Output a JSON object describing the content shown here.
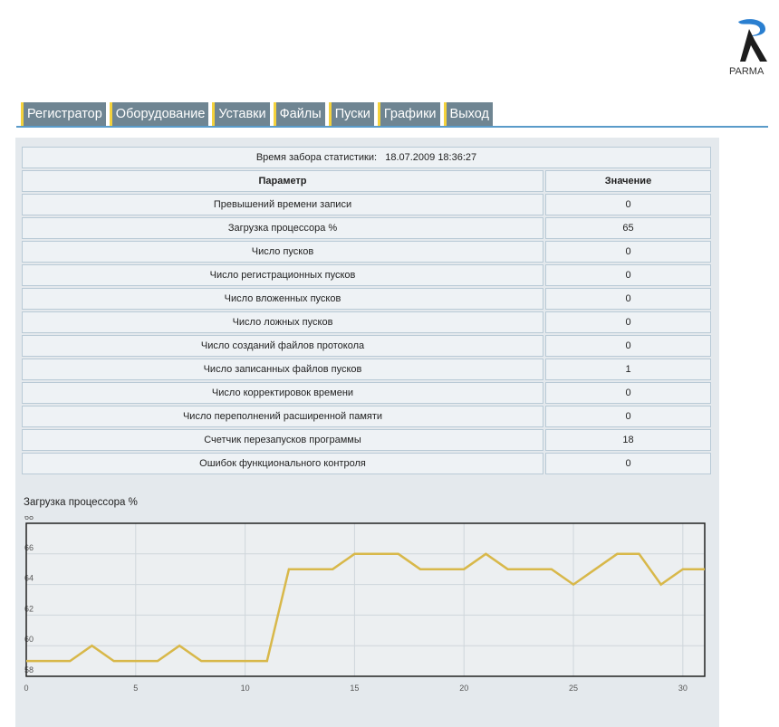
{
  "logo": {
    "name": "parma-logo-icon",
    "text": "PARMA"
  },
  "tabs": [
    {
      "label": "Регистратор"
    },
    {
      "label": "Оборудование"
    },
    {
      "label": "Уставки"
    },
    {
      "label": "Файлы"
    },
    {
      "label": "Пуски"
    },
    {
      "label": "Графики"
    },
    {
      "label": "Выход"
    }
  ],
  "stats": {
    "time_label": "Время забора статистики:",
    "time_value": "18.07.2009 18:36:27",
    "col_param": "Параметр",
    "col_value": "Значение",
    "rows": [
      {
        "param": "Превышений времени записи",
        "value": "0"
      },
      {
        "param": "Загрузка процессора %",
        "value": "65"
      },
      {
        "param": "Число пусков",
        "value": "0"
      },
      {
        "param": "Число регистрационных пусков",
        "value": "0"
      },
      {
        "param": "Число вложенных пусков",
        "value": "0"
      },
      {
        "param": "Число ложных пусков",
        "value": "0"
      },
      {
        "param": "Число созданий файлов протокола",
        "value": "0"
      },
      {
        "param": "Число записанных файлов пусков",
        "value": "1"
      },
      {
        "param": "Число корректировок времени",
        "value": "0"
      },
      {
        "param": "Число переполнений расширенной памяти",
        "value": "0"
      },
      {
        "param": "Счетчик перезапусков программы",
        "value": "18"
      },
      {
        "param": "Ошибок функционального контроля",
        "value": "0"
      }
    ]
  },
  "chart_data": {
    "type": "line",
    "title": "Загрузка процессора %",
    "xlim": [
      0,
      31
    ],
    "ylim": [
      58,
      68
    ],
    "x_ticks": [
      0,
      5,
      10,
      15,
      20,
      25,
      30
    ],
    "y_ticks": [
      58,
      60,
      62,
      64,
      66,
      68
    ],
    "grid": true,
    "color": "#d8b84a",
    "x": [
      0,
      1,
      2,
      3,
      4,
      5,
      6,
      7,
      8,
      9,
      10,
      11,
      12,
      13,
      14,
      15,
      16,
      17,
      18,
      19,
      20,
      21,
      22,
      23,
      24,
      25,
      26,
      27,
      28,
      29,
      30,
      31
    ],
    "values": [
      59,
      59,
      59,
      60,
      59,
      59,
      59,
      60,
      59,
      59,
      59,
      59,
      65,
      65,
      65,
      66,
      66,
      66,
      65,
      65,
      65,
      66,
      65,
      65,
      65,
      64,
      65,
      66,
      66,
      64,
      65,
      65
    ]
  }
}
